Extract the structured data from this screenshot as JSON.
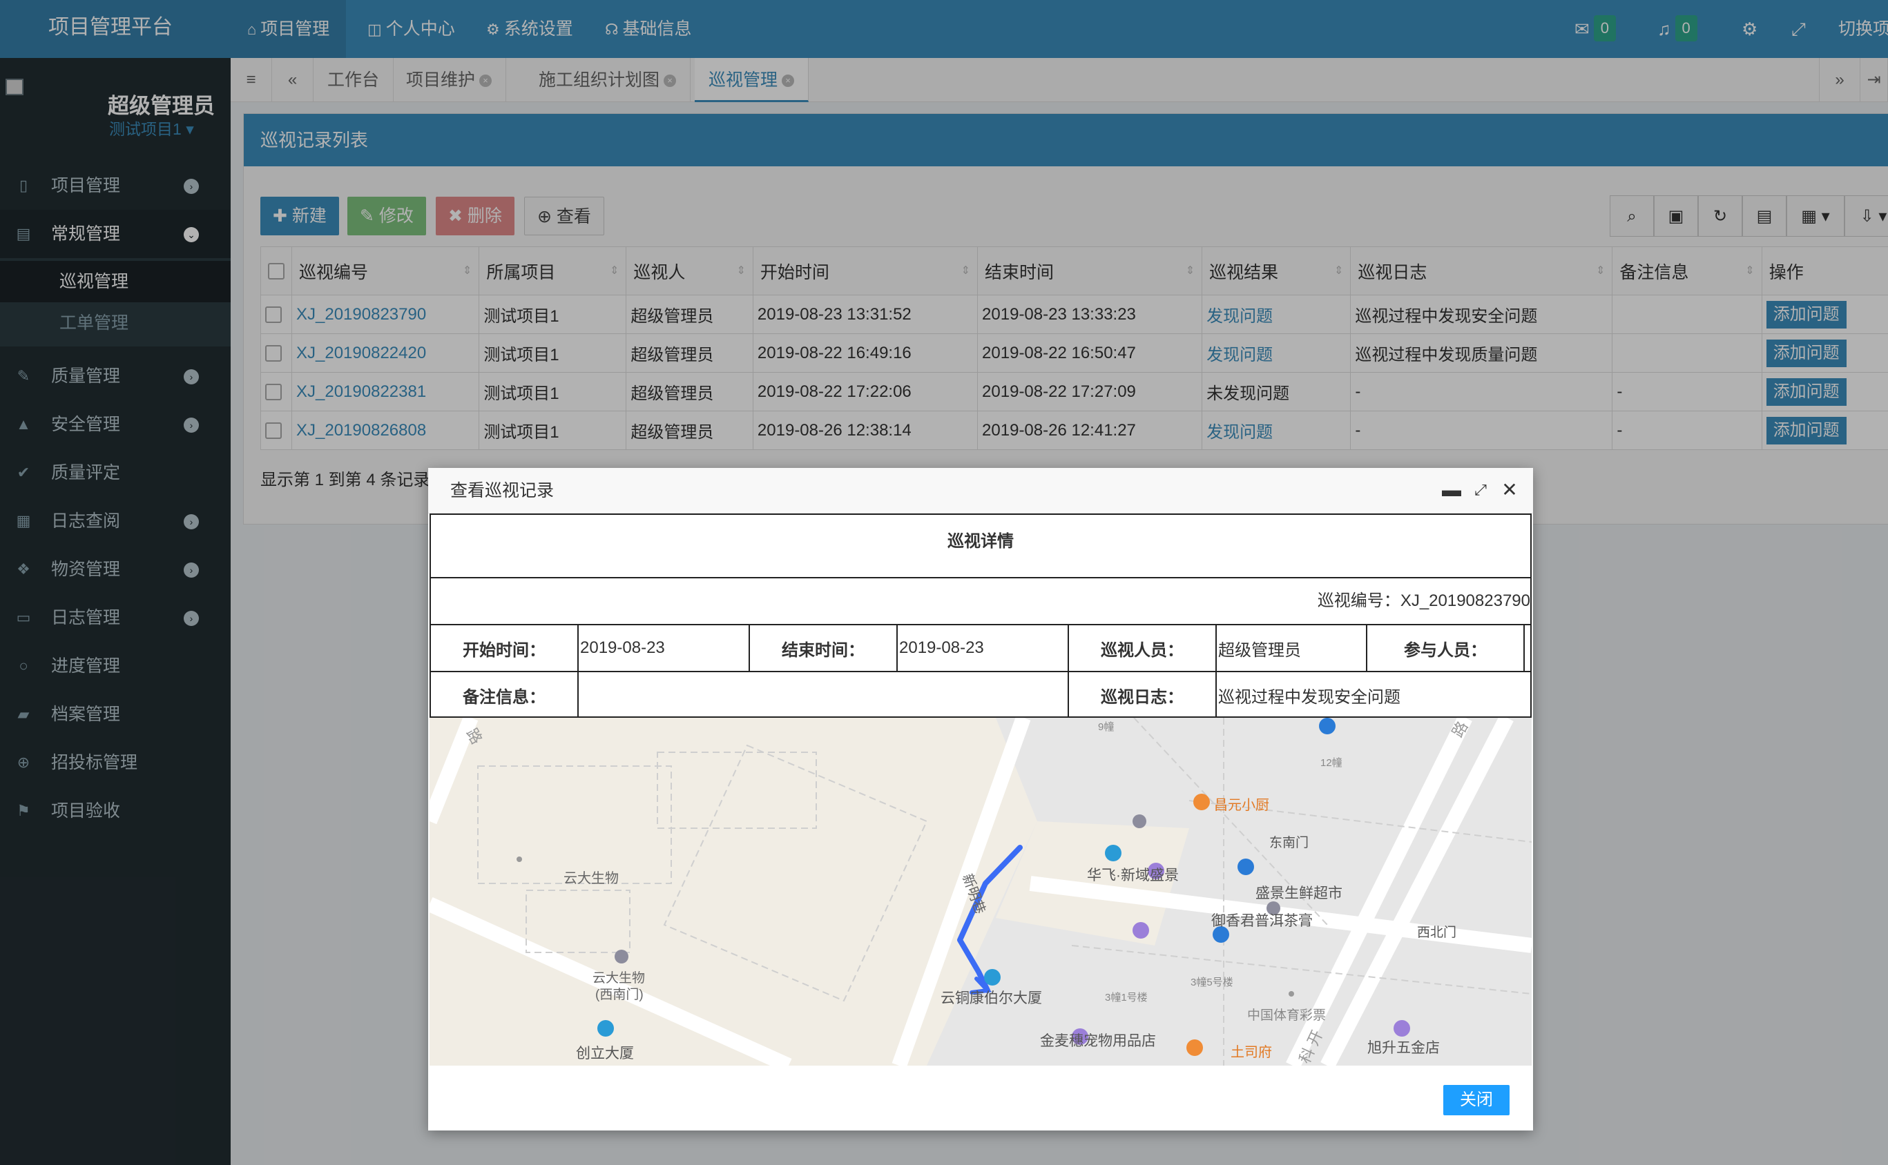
{
  "header": {
    "logo": "项目管理平台",
    "nav": [
      {
        "icon": "home-icon",
        "glyph": "⌂",
        "label": "项目管理"
      },
      {
        "icon": "columns-icon",
        "glyph": "◫",
        "label": "个人中心"
      },
      {
        "icon": "gear-icon",
        "glyph": "⚙",
        "label": "系统设置"
      },
      {
        "icon": "headset-icon",
        "glyph": "☊",
        "label": "基础信息"
      }
    ],
    "mail_count": "0",
    "bell_count": "0",
    "switch_text": "切换项"
  },
  "sidebar": {
    "username": "超级管理员",
    "project": "测试项目1",
    "items": [
      {
        "label": "项目管理",
        "icon": "file-icon",
        "glyph": "▯"
      },
      {
        "label": "常规管理",
        "icon": "server-icon",
        "glyph": "▤"
      },
      {
        "label": "质量管理",
        "icon": "edit-icon",
        "glyph": "✎"
      },
      {
        "label": "安全管理",
        "icon": "warning-icon",
        "glyph": "▲"
      },
      {
        "label": "质量评定",
        "icon": "check-circle-icon",
        "glyph": "✔"
      },
      {
        "label": "日志查阅",
        "icon": "calendar-icon",
        "glyph": "▦"
      },
      {
        "label": "物资管理",
        "icon": "cubes-icon",
        "glyph": "❖"
      },
      {
        "label": "日志管理",
        "icon": "card-icon",
        "glyph": "▭"
      },
      {
        "label": "进度管理",
        "icon": "circle-icon",
        "glyph": "○"
      },
      {
        "label": "档案管理",
        "icon": "book-icon",
        "glyph": "▰"
      },
      {
        "label": "招投标管理",
        "icon": "search-plus-icon",
        "glyph": "⊕"
      },
      {
        "label": "项目验收",
        "icon": "flag-icon",
        "glyph": "⚑"
      }
    ],
    "subitems": [
      "巡视管理",
      "工单管理"
    ]
  },
  "tabs": [
    "工作台",
    "项目维护",
    "施工组织计划图",
    "巡视管理"
  ],
  "panel": {
    "title": "巡视记录列表",
    "buttons": {
      "new": "新建",
      "edit": "修改",
      "delete": "删除",
      "view": "查看"
    },
    "columns": [
      "巡视编号",
      "所属项目",
      "巡视人",
      "开始时间",
      "结束时间",
      "巡视结果",
      "巡视日志",
      "备注信息",
      "操作"
    ],
    "rows": [
      {
        "id": "XJ_20190823790",
        "project": "测试项目1",
        "person": "超级管理员",
        "start": "2019-08-23 13:31:52",
        "end": "2019-08-23 13:33:23",
        "result": "发现问题",
        "result_link": true,
        "log": "巡视过程中发现安全问题",
        "note": "",
        "action": "添加问题"
      },
      {
        "id": "XJ_20190822420",
        "project": "测试项目1",
        "person": "超级管理员",
        "start": "2019-08-22 16:49:16",
        "end": "2019-08-22 16:50:47",
        "result": "发现问题",
        "result_link": true,
        "log": "巡视过程中发现质量问题",
        "note": "",
        "action": "添加问题"
      },
      {
        "id": "XJ_20190822381",
        "project": "测试项目1",
        "person": "超级管理员",
        "start": "2019-08-22 17:22:06",
        "end": "2019-08-22 17:27:09",
        "result": "未发现问题",
        "result_link": false,
        "log": "-",
        "note": "-",
        "action": "添加问题"
      },
      {
        "id": "XJ_20190826808",
        "project": "测试项目1",
        "person": "超级管理员",
        "start": "2019-08-26 12:38:14",
        "end": "2019-08-26 12:41:27",
        "result": "发现问题",
        "result_link": true,
        "log": "-",
        "note": "-",
        "action": "添加问题"
      }
    ],
    "page_info": "显示第 1 到第 4 条记录"
  },
  "modal": {
    "title": "查看巡视记录",
    "detail_title": "巡视详情",
    "record_no_label": "巡视编号：",
    "record_no": "XJ_20190823790",
    "start_label": "开始时间：",
    "start_value": "2019-08-23",
    "end_label": "结束时间：",
    "end_value": "2019-08-23",
    "inspector_label": "巡视人员：",
    "inspector_value": "超级管理员",
    "participants_label": "参与人员：",
    "participants_value": "",
    "note_label": "备注信息：",
    "note_value": "",
    "log_label": "巡视日志：",
    "log_value": "巡视过程中发现安全问题",
    "close": "关闭"
  },
  "map": {
    "labels": {
      "bld9": "9幢",
      "bld12": "12幢",
      "changyuan": "昌元小厨",
      "dongnanmen": "东南门",
      "huafei": "华飞·新域盛景",
      "shengjing": "盛景生鲜超市",
      "yuxiang": "御香君普洱茶膏",
      "xibeimen": "西北门",
      "yunda": "云大生物",
      "yunda_w1": "云大生物",
      "yunda_w2": "(西南门)",
      "xinming": "新明巷",
      "yuntong": "云铜康伯尔大厦",
      "b3_5": "3幢5号楼",
      "b3_1": "3幢1号楼",
      "lottery": "中国体育彩票",
      "jinmai": "金麦穗宠物用品店",
      "tusifu": "土司府",
      "chuangli": "创立大厦",
      "xusheng": "旭升五金店",
      "road1": "路",
      "road2": "路",
      "kekai": "科 开"
    },
    "route_color": "#3b6cf5"
  }
}
